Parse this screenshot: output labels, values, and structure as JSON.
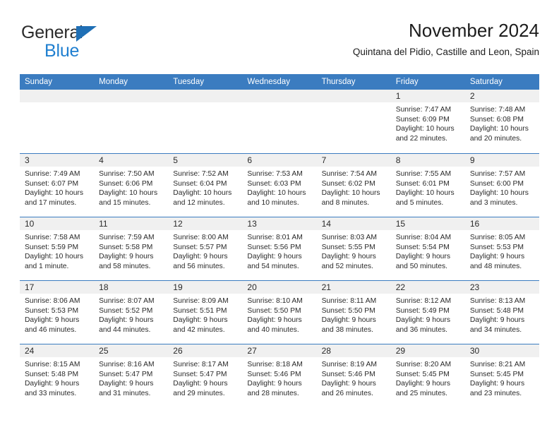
{
  "brand": {
    "name_top": "General",
    "name_bottom": "Blue",
    "accent_color": "#1f7fd0",
    "triangle_color": "#1f6fb5"
  },
  "header": {
    "title": "November 2024",
    "subtitle": "Quintana del Pidio, Castille and Leon, Spain"
  },
  "calendar": {
    "header_bg": "#3b7cc0",
    "day_band_bg": "#f0f0f0",
    "weekdays": [
      "Sunday",
      "Monday",
      "Tuesday",
      "Wednesday",
      "Thursday",
      "Friday",
      "Saturday"
    ],
    "weeks": [
      [
        {
          "day": "",
          "sunrise": "",
          "sunset": "",
          "daylight": "",
          "empty": true
        },
        {
          "day": "",
          "sunrise": "",
          "sunset": "",
          "daylight": "",
          "empty": true
        },
        {
          "day": "",
          "sunrise": "",
          "sunset": "",
          "daylight": "",
          "empty": true
        },
        {
          "day": "",
          "sunrise": "",
          "sunset": "",
          "daylight": "",
          "empty": true
        },
        {
          "day": "",
          "sunrise": "",
          "sunset": "",
          "daylight": "",
          "empty": true
        },
        {
          "day": "1",
          "sunrise": "Sunrise: 7:47 AM",
          "sunset": "Sunset: 6:09 PM",
          "daylight": "Daylight: 10 hours and 22 minutes."
        },
        {
          "day": "2",
          "sunrise": "Sunrise: 7:48 AM",
          "sunset": "Sunset: 6:08 PM",
          "daylight": "Daylight: 10 hours and 20 minutes."
        }
      ],
      [
        {
          "day": "3",
          "sunrise": "Sunrise: 7:49 AM",
          "sunset": "Sunset: 6:07 PM",
          "daylight": "Daylight: 10 hours and 17 minutes."
        },
        {
          "day": "4",
          "sunrise": "Sunrise: 7:50 AM",
          "sunset": "Sunset: 6:06 PM",
          "daylight": "Daylight: 10 hours and 15 minutes."
        },
        {
          "day": "5",
          "sunrise": "Sunrise: 7:52 AM",
          "sunset": "Sunset: 6:04 PM",
          "daylight": "Daylight: 10 hours and 12 minutes."
        },
        {
          "day": "6",
          "sunrise": "Sunrise: 7:53 AM",
          "sunset": "Sunset: 6:03 PM",
          "daylight": "Daylight: 10 hours and 10 minutes."
        },
        {
          "day": "7",
          "sunrise": "Sunrise: 7:54 AM",
          "sunset": "Sunset: 6:02 PM",
          "daylight": "Daylight: 10 hours and 8 minutes."
        },
        {
          "day": "8",
          "sunrise": "Sunrise: 7:55 AM",
          "sunset": "Sunset: 6:01 PM",
          "daylight": "Daylight: 10 hours and 5 minutes."
        },
        {
          "day": "9",
          "sunrise": "Sunrise: 7:57 AM",
          "sunset": "Sunset: 6:00 PM",
          "daylight": "Daylight: 10 hours and 3 minutes."
        }
      ],
      [
        {
          "day": "10",
          "sunrise": "Sunrise: 7:58 AM",
          "sunset": "Sunset: 5:59 PM",
          "daylight": "Daylight: 10 hours and 1 minute."
        },
        {
          "day": "11",
          "sunrise": "Sunrise: 7:59 AM",
          "sunset": "Sunset: 5:58 PM",
          "daylight": "Daylight: 9 hours and 58 minutes."
        },
        {
          "day": "12",
          "sunrise": "Sunrise: 8:00 AM",
          "sunset": "Sunset: 5:57 PM",
          "daylight": "Daylight: 9 hours and 56 minutes."
        },
        {
          "day": "13",
          "sunrise": "Sunrise: 8:01 AM",
          "sunset": "Sunset: 5:56 PM",
          "daylight": "Daylight: 9 hours and 54 minutes."
        },
        {
          "day": "14",
          "sunrise": "Sunrise: 8:03 AM",
          "sunset": "Sunset: 5:55 PM",
          "daylight": "Daylight: 9 hours and 52 minutes."
        },
        {
          "day": "15",
          "sunrise": "Sunrise: 8:04 AM",
          "sunset": "Sunset: 5:54 PM",
          "daylight": "Daylight: 9 hours and 50 minutes."
        },
        {
          "day": "16",
          "sunrise": "Sunrise: 8:05 AM",
          "sunset": "Sunset: 5:53 PM",
          "daylight": "Daylight: 9 hours and 48 minutes."
        }
      ],
      [
        {
          "day": "17",
          "sunrise": "Sunrise: 8:06 AM",
          "sunset": "Sunset: 5:53 PM",
          "daylight": "Daylight: 9 hours and 46 minutes."
        },
        {
          "day": "18",
          "sunrise": "Sunrise: 8:07 AM",
          "sunset": "Sunset: 5:52 PM",
          "daylight": "Daylight: 9 hours and 44 minutes."
        },
        {
          "day": "19",
          "sunrise": "Sunrise: 8:09 AM",
          "sunset": "Sunset: 5:51 PM",
          "daylight": "Daylight: 9 hours and 42 minutes."
        },
        {
          "day": "20",
          "sunrise": "Sunrise: 8:10 AM",
          "sunset": "Sunset: 5:50 PM",
          "daylight": "Daylight: 9 hours and 40 minutes."
        },
        {
          "day": "21",
          "sunrise": "Sunrise: 8:11 AM",
          "sunset": "Sunset: 5:50 PM",
          "daylight": "Daylight: 9 hours and 38 minutes."
        },
        {
          "day": "22",
          "sunrise": "Sunrise: 8:12 AM",
          "sunset": "Sunset: 5:49 PM",
          "daylight": "Daylight: 9 hours and 36 minutes."
        },
        {
          "day": "23",
          "sunrise": "Sunrise: 8:13 AM",
          "sunset": "Sunset: 5:48 PM",
          "daylight": "Daylight: 9 hours and 34 minutes."
        }
      ],
      [
        {
          "day": "24",
          "sunrise": "Sunrise: 8:15 AM",
          "sunset": "Sunset: 5:48 PM",
          "daylight": "Daylight: 9 hours and 33 minutes."
        },
        {
          "day": "25",
          "sunrise": "Sunrise: 8:16 AM",
          "sunset": "Sunset: 5:47 PM",
          "daylight": "Daylight: 9 hours and 31 minutes."
        },
        {
          "day": "26",
          "sunrise": "Sunrise: 8:17 AM",
          "sunset": "Sunset: 5:47 PM",
          "daylight": "Daylight: 9 hours and 29 minutes."
        },
        {
          "day": "27",
          "sunrise": "Sunrise: 8:18 AM",
          "sunset": "Sunset: 5:46 PM",
          "daylight": "Daylight: 9 hours and 28 minutes."
        },
        {
          "day": "28",
          "sunrise": "Sunrise: 8:19 AM",
          "sunset": "Sunset: 5:46 PM",
          "daylight": "Daylight: 9 hours and 26 minutes."
        },
        {
          "day": "29",
          "sunrise": "Sunrise: 8:20 AM",
          "sunset": "Sunset: 5:45 PM",
          "daylight": "Daylight: 9 hours and 25 minutes."
        },
        {
          "day": "30",
          "sunrise": "Sunrise: 8:21 AM",
          "sunset": "Sunset: 5:45 PM",
          "daylight": "Daylight: 9 hours and 23 minutes."
        }
      ]
    ]
  }
}
